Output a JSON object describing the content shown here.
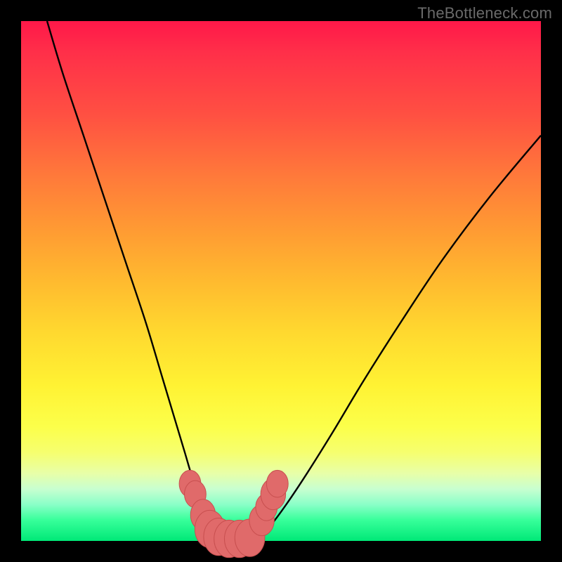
{
  "watermark": {
    "text": "TheBottleneck.com"
  },
  "colors": {
    "frame": "#000000",
    "curve": "#000000",
    "marker_fill": "#e06a6a",
    "marker_stroke": "#c84f4f"
  },
  "chart_data": {
    "type": "line",
    "title": "",
    "xlabel": "",
    "ylabel": "",
    "xlim": [
      0,
      100
    ],
    "ylim": [
      0,
      100
    ],
    "grid": false,
    "legend": false,
    "annotations": [],
    "series": [
      {
        "name": "left-branch",
        "x": [
          5,
          8,
          12,
          16,
          20,
          24,
          27,
          30,
          31.5,
          33,
          34.5,
          36,
          37,
          37.8
        ],
        "y": [
          100,
          90,
          78,
          66,
          54,
          42,
          32,
          22,
          17,
          12,
          8,
          4.5,
          2,
          0.8
        ]
      },
      {
        "name": "valley-floor",
        "x": [
          37.8,
          39,
          40.5,
          42,
          43.5,
          45,
          46
        ],
        "y": [
          0.8,
          0.3,
          0.2,
          0.2,
          0.3,
          0.6,
          1.2
        ]
      },
      {
        "name": "right-branch",
        "x": [
          46,
          48,
          51,
          55,
          60,
          66,
          73,
          81,
          90,
          100
        ],
        "y": [
          1.2,
          3,
          7,
          13,
          21,
          31,
          42,
          54,
          66,
          78
        ]
      }
    ],
    "markers": [
      {
        "x": 32.5,
        "y": 11,
        "r": 1.3
      },
      {
        "x": 33.5,
        "y": 9,
        "r": 1.3
      },
      {
        "x": 35.0,
        "y": 5,
        "r": 1.5
      },
      {
        "x": 36.3,
        "y": 2.3,
        "r": 1.8
      },
      {
        "x": 38.0,
        "y": 0.8,
        "r": 1.8
      },
      {
        "x": 40.0,
        "y": 0.4,
        "r": 1.8
      },
      {
        "x": 42.0,
        "y": 0.4,
        "r": 1.8
      },
      {
        "x": 44.0,
        "y": 0.6,
        "r": 1.8
      },
      {
        "x": 46.3,
        "y": 4.0,
        "r": 1.5
      },
      {
        "x": 47.2,
        "y": 6.5,
        "r": 1.3
      },
      {
        "x": 48.5,
        "y": 9.0,
        "r": 1.5
      },
      {
        "x": 49.3,
        "y": 11.0,
        "r": 1.3
      }
    ]
  }
}
